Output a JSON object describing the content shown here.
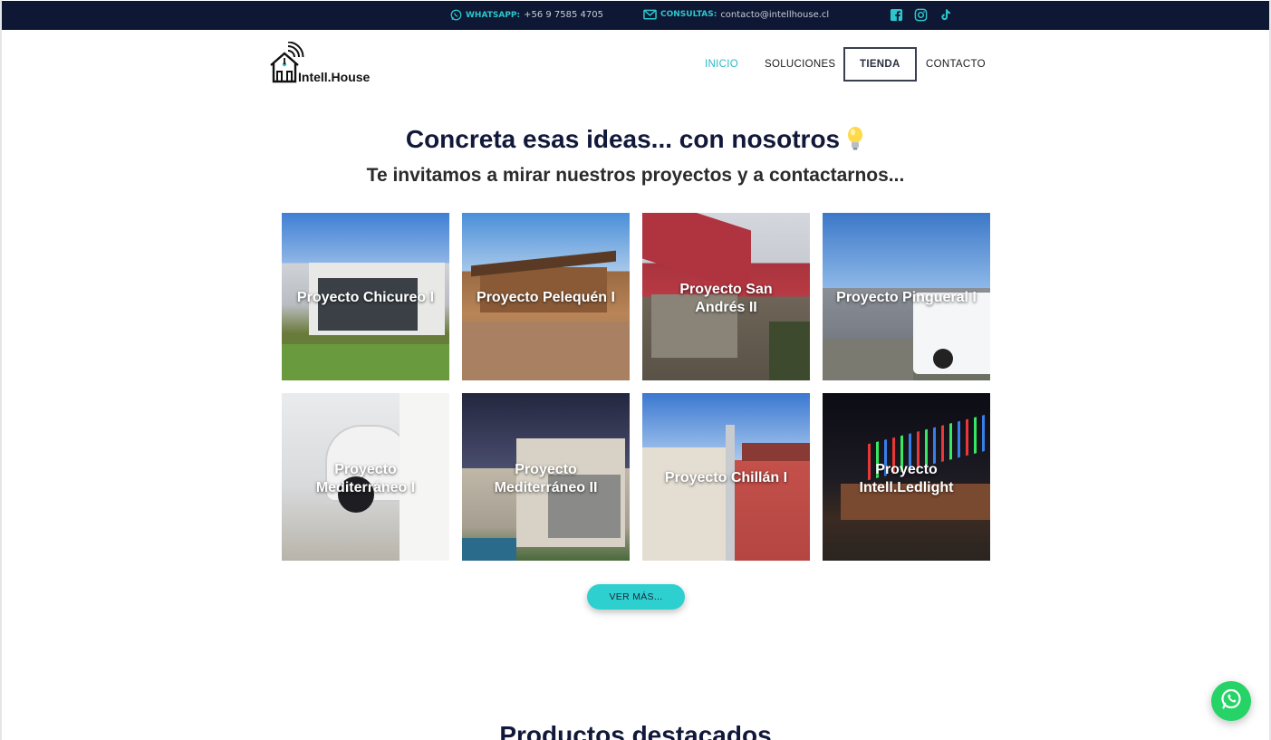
{
  "topbar": {
    "whatsapp_label": "WHATSAPP:",
    "whatsapp_value": "+56 9 7585 4705",
    "email_label": "CONSULTAS:",
    "email_value": "contacto@intellhouse.cl",
    "social_icons": [
      "facebook-icon",
      "instagram-icon",
      "tiktok-icon"
    ]
  },
  "brand": {
    "name": "Intell.House"
  },
  "nav": {
    "items": [
      {
        "label": "INICIO",
        "active": true
      },
      {
        "label": "SOLUCIONES",
        "active": false
      },
      {
        "label": "TIENDA",
        "active": false
      },
      {
        "label": "CONTACTO",
        "active": false
      }
    ]
  },
  "hero": {
    "title": "Concreta esas ideas... con nosotros",
    "title_emoji": "lightbulb-icon",
    "subtitle": "Te invitamos a mirar nuestros proyectos y a contactarnos..."
  },
  "projects": [
    {
      "label": "Proyecto Chicureo I"
    },
    {
      "label": "Proyecto Pelequén I"
    },
    {
      "label": "Proyecto San Andrés II"
    },
    {
      "label": "Proyecto Pingueral I"
    },
    {
      "label": "Proyecto Mediterráneo I"
    },
    {
      "label": "Proyecto Mediterráneo II"
    },
    {
      "label": "Proyecto Chillán I"
    },
    {
      "label": "Proyecto Intell.Ledlight"
    }
  ],
  "more_button": {
    "label": "VER MÁS..."
  },
  "products": {
    "title": "Productos destacados"
  },
  "colors": {
    "topbar_bg": "#0e1733",
    "accent": "#2dd0cf",
    "nav_active": "#2bb8c6",
    "whatsapp": "#25d366"
  }
}
